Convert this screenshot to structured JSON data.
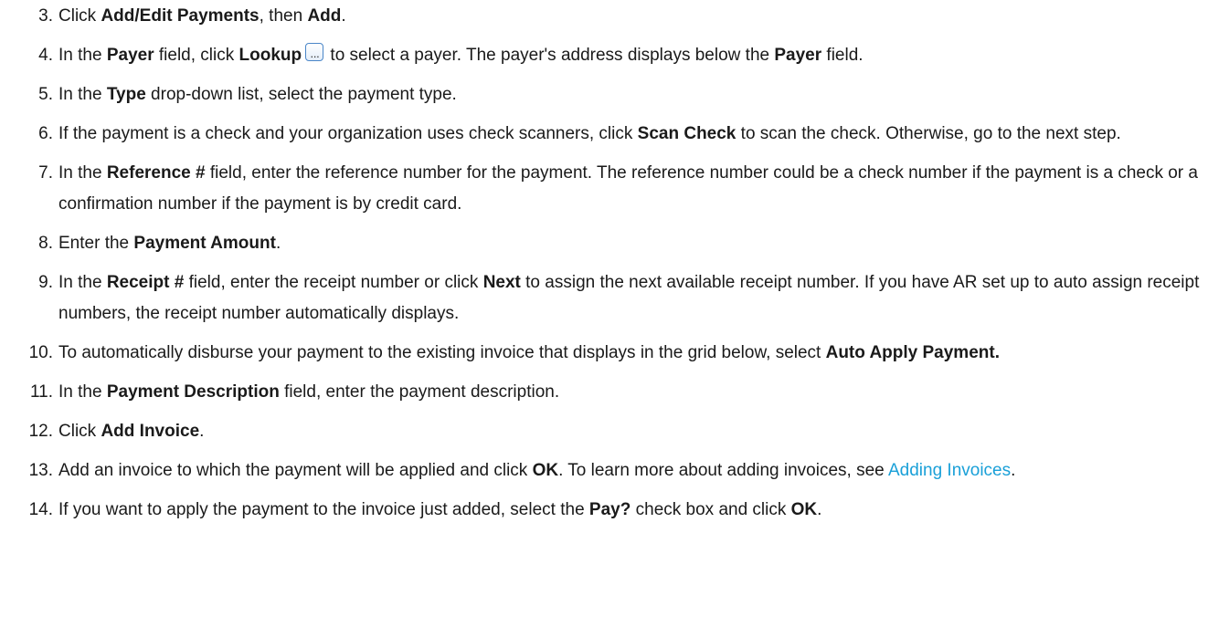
{
  "steps": [
    {
      "num": "3.",
      "parts": [
        {
          "t": "Click "
        },
        {
          "t": "Add/Edit Payments",
          "b": true
        },
        {
          "t": ", then "
        },
        {
          "t": "Add",
          "b": true
        },
        {
          "t": "."
        }
      ]
    },
    {
      "num": "4.",
      "parts": [
        {
          "t": "In the "
        },
        {
          "t": "Payer",
          "b": true
        },
        {
          "t": " field, click "
        },
        {
          "t": "Lookup",
          "b": true
        },
        {
          "icon": "lookup-icon"
        },
        {
          "t": " to select a payer. The payer's address displays below the "
        },
        {
          "t": "Payer",
          "b": true
        },
        {
          "t": " field."
        }
      ]
    },
    {
      "num": "5.",
      "parts": [
        {
          "t": "In the "
        },
        {
          "t": "Type",
          "b": true
        },
        {
          "t": " drop-down list, select the payment type."
        }
      ]
    },
    {
      "num": "6.",
      "parts": [
        {
          "t": "If the payment is a check and your organization uses check scanners, click "
        },
        {
          "t": "Scan Check",
          "b": true
        },
        {
          "t": " to scan the check. Otherwise, go to the next step."
        }
      ]
    },
    {
      "num": "7.",
      "parts": [
        {
          "t": "In the "
        },
        {
          "t": "Reference #",
          "b": true
        },
        {
          "t": " field, enter the reference number for the payment. The reference number could be a check number if the payment is a check or a confirmation number if the payment is by credit card."
        }
      ]
    },
    {
      "num": "8.",
      "parts": [
        {
          "t": "Enter the "
        },
        {
          "t": "Payment Amount",
          "b": true
        },
        {
          "t": "."
        }
      ]
    },
    {
      "num": "9.",
      "parts": [
        {
          "t": "In the "
        },
        {
          "t": "Receipt #",
          "b": true
        },
        {
          "t": " field, enter the receipt number or click "
        },
        {
          "t": "Next",
          "b": true
        },
        {
          "t": " to assign the next available receipt number. If you have AR set up to auto assign receipt numbers, the receipt number automatically displays."
        }
      ]
    },
    {
      "num": "10.",
      "parts": [
        {
          "t": "To automatically disburse your payment to the existing invoice that displays in the grid below, select "
        },
        {
          "t": "Auto Apply Payment.",
          "b": true
        }
      ]
    },
    {
      "num": "11.",
      "parts": [
        {
          "t": "In the "
        },
        {
          "t": "Payment Description",
          "b": true
        },
        {
          "t": " field, enter the payment description."
        }
      ]
    },
    {
      "num": "12.",
      "parts": [
        {
          "t": "Click "
        },
        {
          "t": "Add Invoice",
          "b": true
        },
        {
          "t": "."
        }
      ]
    },
    {
      "num": "13.",
      "parts": [
        {
          "t": "Add an invoice to which the payment will be applied and click "
        },
        {
          "t": "OK",
          "b": true
        },
        {
          "t": ". To learn more about adding invoices, see "
        },
        {
          "t": "Adding Invoices",
          "link": true
        },
        {
          "t": "."
        }
      ]
    },
    {
      "num": "14.",
      "parts": [
        {
          "t": "If you want to apply the payment to the invoice just added, select the "
        },
        {
          "t": "Pay?",
          "b": true
        },
        {
          "t": " check box and click "
        },
        {
          "t": "OK",
          "b": true
        },
        {
          "t": "."
        }
      ]
    }
  ],
  "colors": {
    "text": "#1a1a1a",
    "link": "#1aa0d8",
    "icon_border": "#4a86c8"
  }
}
